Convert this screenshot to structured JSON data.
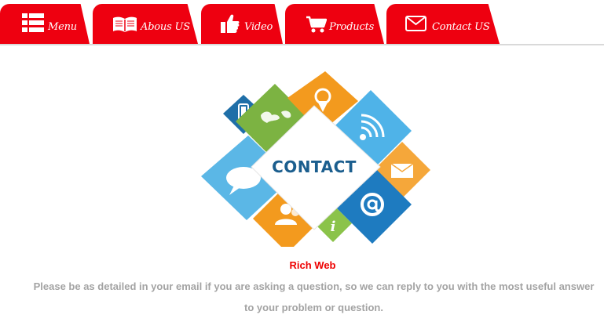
{
  "nav": {
    "tabs": [
      {
        "label": "Menu",
        "icon": "list-icon"
      },
      {
        "label": "Abous US",
        "icon": "book-icon"
      },
      {
        "label": "Video",
        "icon": "thumbs-up-icon"
      },
      {
        "label": "Products",
        "icon": "cart-icon"
      },
      {
        "label": "Contact US",
        "icon": "envelope-icon"
      }
    ],
    "active_tab": "Contact US",
    "tab_color": "#ee0010"
  },
  "hero": {
    "title": "CONTACT",
    "icons": [
      "map-pin-icon",
      "world-map-icon",
      "rss-icon",
      "mobile-phone-icon",
      "speech-bubble-icon",
      "mail-icon",
      "at-sign-icon",
      "users-icon",
      "info-icon"
    ]
  },
  "content": {
    "brand": "Rich Web",
    "description": "Please be as detailed in your email if you are asking a question, so we can reply to you with the most useful answer to your problem or question."
  },
  "colors": {
    "brand_text": "#ee0000",
    "description_text": "#a3a3a3",
    "contact_word": "#1b5e8e"
  }
}
